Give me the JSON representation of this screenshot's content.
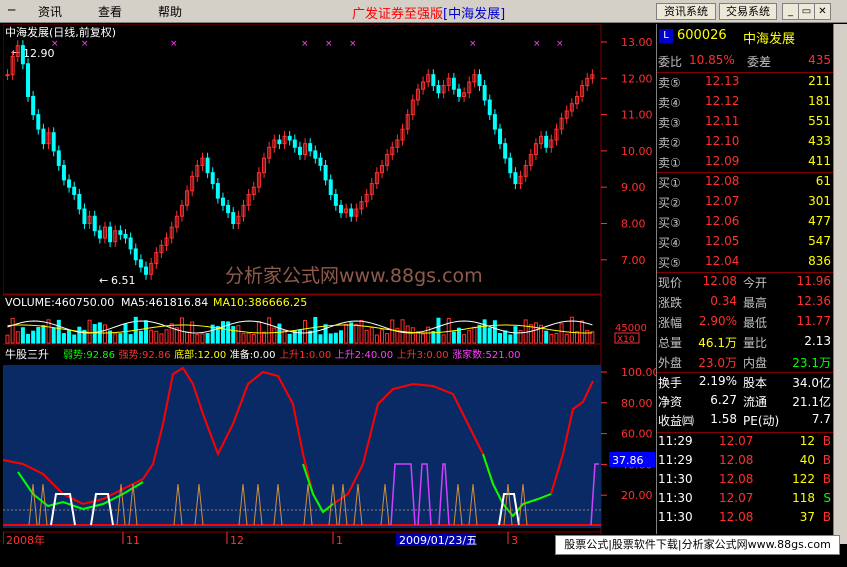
{
  "menu": {
    "items": [
      "资讯",
      "查看",
      "帮助"
    ]
  },
  "title": {
    "main": "广发证券至强版",
    "sub": "[中海发展]"
  },
  "toolbar": {
    "info_system": "资讯系统",
    "trade_system": "交易系统"
  },
  "chart": {
    "header": "中海发展(日线,前复权)",
    "high_label": "12.90",
    "low_label": "6.51",
    "watermark": "分析家公式网www.88gs.com",
    "price_ticks": [
      "13.00",
      "12.00",
      "11.00",
      "10.00",
      "9.00",
      "8.00",
      "7.00"
    ],
    "volume_header": {
      "vol": "VOLUME:460750.00",
      "ma5": "MA5:461816.84",
      "ma10": "MA10:386666.25"
    },
    "volume_tick": "45000",
    "volume_unit": "X10",
    "indicator_name": "牛股三升",
    "indicator_fields": [
      {
        "text": "弱势:92.86",
        "color": "#00ff00"
      },
      {
        "text": "强势:92.86",
        "color": "#ff3030"
      },
      {
        "text": "底部:12.00",
        "color": "#ffff00"
      },
      {
        "text": "准备:0.00",
        "color": "#ffffff"
      },
      {
        "text": "上升1:0.00",
        "color": "#ff3030"
      },
      {
        "text": "上升2:40.00",
        "color": "#ff40ff"
      },
      {
        "text": "上升3:0.00",
        "color": "#ff3030"
      },
      {
        "text": "涨家数:521.00",
        "color": "#ff40ff"
      }
    ],
    "indicator_ticks": [
      "100.00",
      "80.00",
      "60.00",
      "40.00",
      "20.00"
    ],
    "indicator_current": "37.86",
    "date_labels": [
      "2008年",
      "11",
      "12",
      "1",
      "3"
    ],
    "date_cursor": "2009/01/23/五"
  },
  "quote": {
    "code": "600026",
    "name": "中海发展",
    "wei_bi_label": "委比",
    "wei_bi": "10.85%",
    "wei_cha_label": "委差",
    "wei_cha": "435",
    "asks": [
      {
        "label": "卖⑤",
        "price": "12.13",
        "vol": "211"
      },
      {
        "label": "卖④",
        "price": "12.12",
        "vol": "181"
      },
      {
        "label": "卖③",
        "price": "12.11",
        "vol": "551"
      },
      {
        "label": "卖②",
        "price": "12.10",
        "vol": "433"
      },
      {
        "label": "卖①",
        "price": "12.09",
        "vol": "411"
      }
    ],
    "bids": [
      {
        "label": "买①",
        "price": "12.08",
        "vol": "61"
      },
      {
        "label": "买②",
        "price": "12.07",
        "vol": "301"
      },
      {
        "label": "买③",
        "price": "12.06",
        "vol": "477"
      },
      {
        "label": "买④",
        "price": "12.05",
        "vol": "547"
      },
      {
        "label": "买⑤",
        "price": "12.04",
        "vol": "836"
      }
    ],
    "stats": [
      {
        "l1": "现价",
        "v1": "12.08",
        "c1": "#ff3030",
        "l2": "今开",
        "v2": "11.96",
        "c2": "#ff3030"
      },
      {
        "l1": "涨跌",
        "v1": "0.34",
        "c1": "#ff3030",
        "l2": "最高",
        "v2": "12.36",
        "c2": "#ff3030"
      },
      {
        "l1": "涨幅",
        "v1": "2.90%",
        "c1": "#ff3030",
        "l2": "最低",
        "v2": "11.77",
        "c2": "#ff3030"
      },
      {
        "l1": "总量",
        "v1": "46.1万",
        "c1": "#ffff00",
        "l2": "量比",
        "v2": "2.13",
        "c2": "#ffffff"
      },
      {
        "l1": "外盘",
        "v1": "23.0万",
        "c1": "#ff3030",
        "l2": "内盘",
        "v2": "23.1万",
        "c2": "#00ff00"
      }
    ],
    "stats2": [
      {
        "l1": "换手",
        "v1": "2.19%",
        "l2": "股本",
        "v2": "34.0亿"
      },
      {
        "l1": "净资",
        "v1": "6.27",
        "l2": "流通",
        "v2": "21.1亿"
      },
      {
        "l1": "收益㈣",
        "v1": "1.58",
        "l2": "PE(动)",
        "v2": "7.7"
      }
    ],
    "ticks": [
      {
        "time": "11:29",
        "price": "12.07",
        "vol": "12",
        "side": "B"
      },
      {
        "time": "11:29",
        "price": "12.08",
        "vol": "40",
        "side": "B"
      },
      {
        "time": "11:30",
        "price": "12.08",
        "vol": "122",
        "side": "B"
      },
      {
        "time": "11:30",
        "price": "12.07",
        "vol": "118",
        "side": "S"
      },
      {
        "time": "11:30",
        "price": "12.08",
        "vol": "37",
        "side": "B"
      }
    ]
  },
  "footer": {
    "ad": "股票公式|股票软件下载|分析家公式网www.88gs.com"
  }
}
